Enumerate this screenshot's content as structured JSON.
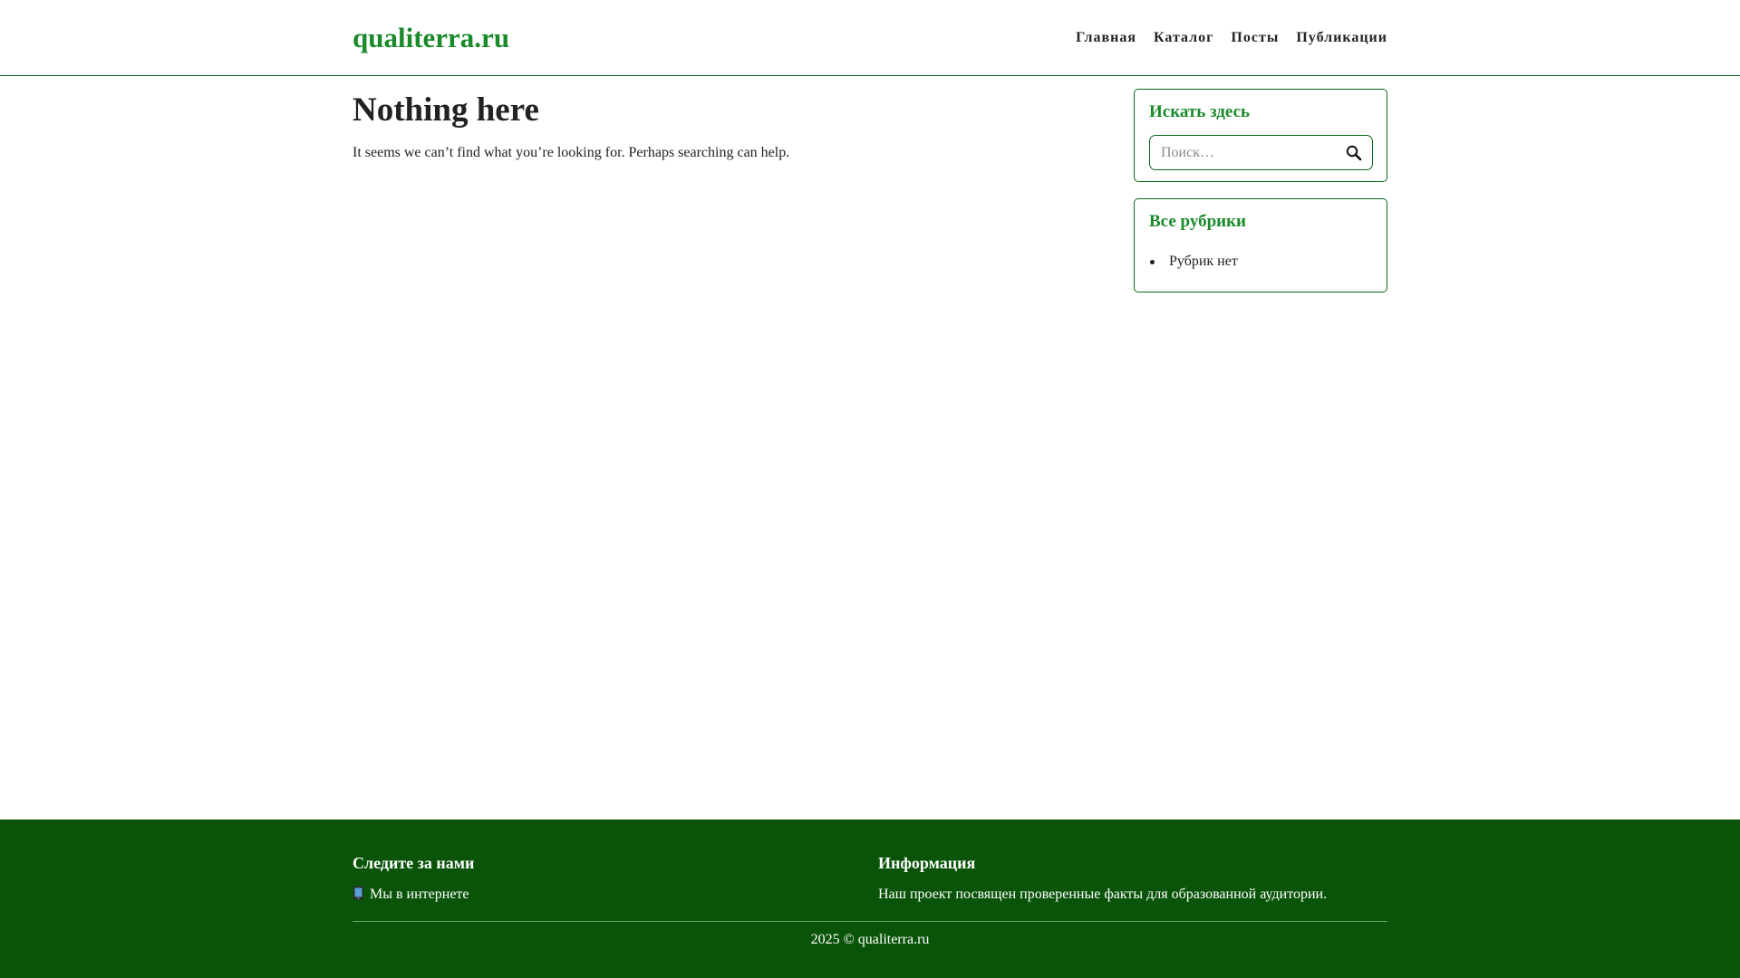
{
  "header": {
    "logo": "qualiterra.ru",
    "nav": [
      {
        "label": "Главная"
      },
      {
        "label": "Каталог"
      },
      {
        "label": "Посты"
      },
      {
        "label": "Публикации"
      }
    ]
  },
  "main": {
    "title": "Nothing here",
    "text": "It seems we can’t find what you’re looking for. Perhaps searching can help."
  },
  "sidebar": {
    "search": {
      "title": "Искать здесь",
      "placeholder": "Поиск…",
      "button_icon": "search-icon"
    },
    "categories": {
      "title": "Все рубрики",
      "items": [
        "Рубрик нет"
      ]
    }
  },
  "footer": {
    "follow": {
      "title": "Следите за нами",
      "link_icon": "phone-icon",
      "link_text": "Мы в интернете"
    },
    "info": {
      "title": "Информация",
      "text": "Наш проект посвящен проверенные факты для образованной аудитории."
    },
    "copyright": "2025 © qualiterra.ru"
  },
  "colors": {
    "brand": "#1a8a2a",
    "border": "#0a6b16",
    "footer_bg": "#0a5409"
  }
}
